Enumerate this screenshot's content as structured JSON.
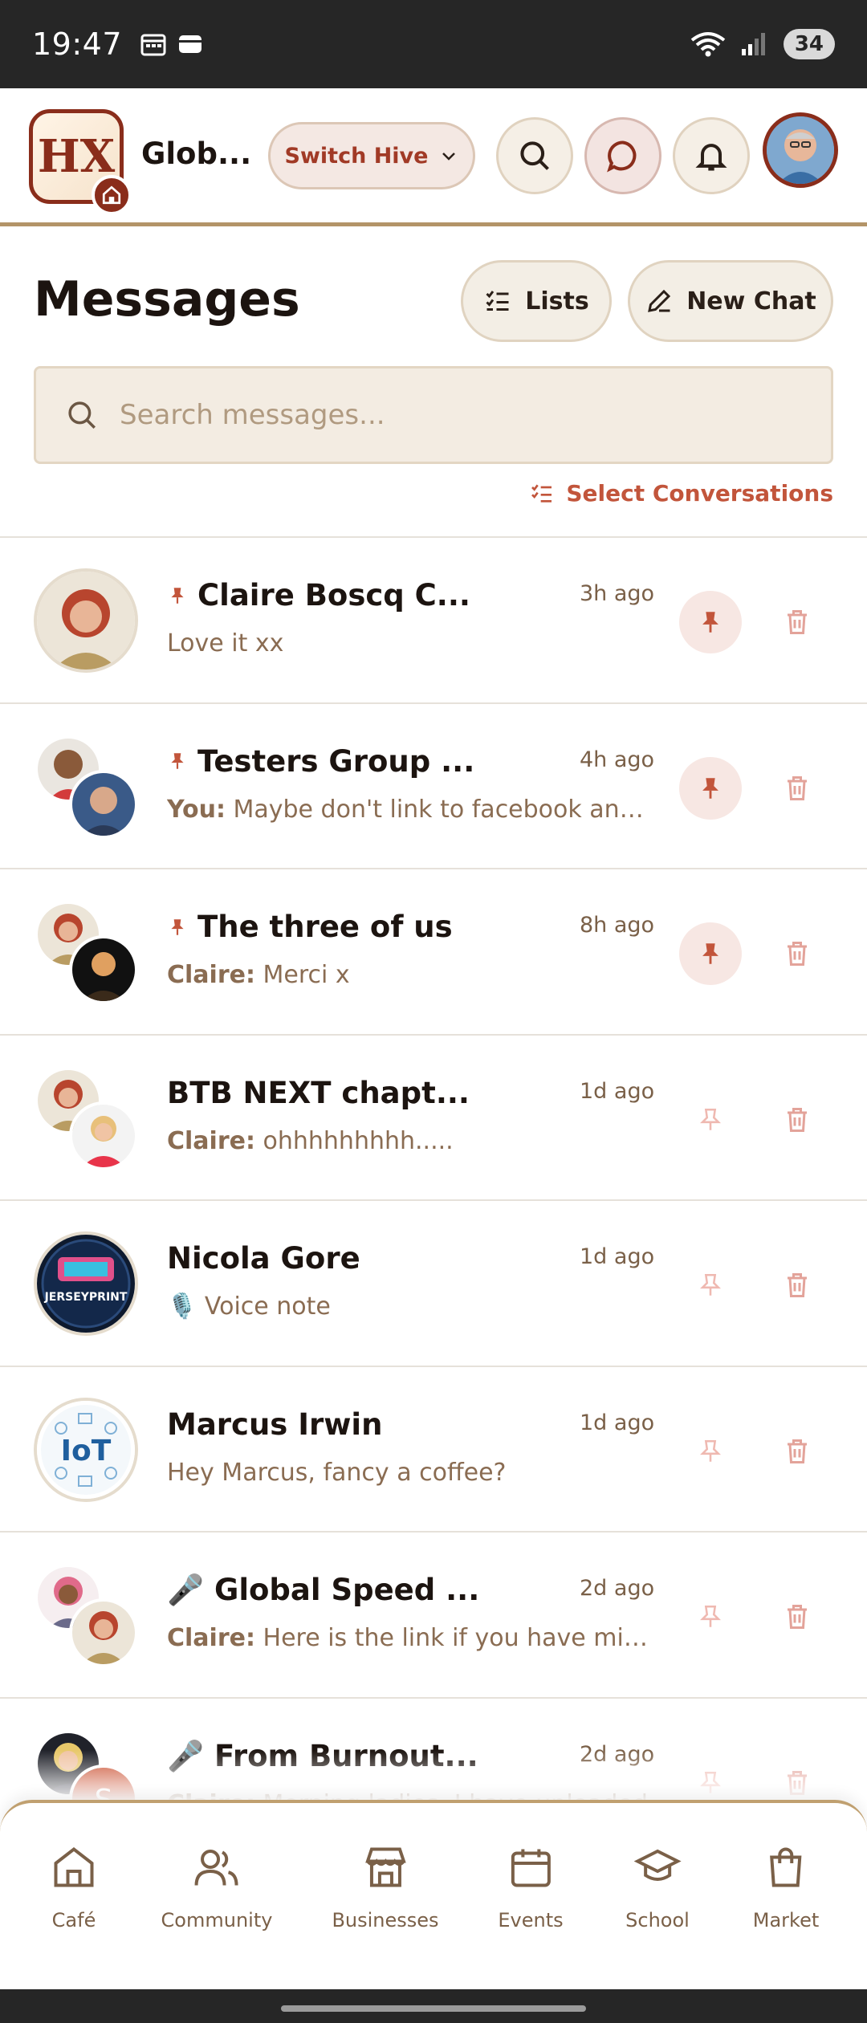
{
  "status_bar": {
    "time": "19:47",
    "battery": "34"
  },
  "header": {
    "logo_text": "HX",
    "hive_name": "Glob...",
    "switch_hive_label": "Switch Hive"
  },
  "page": {
    "title": "Messages",
    "lists_label": "Lists",
    "new_chat_label": "New Chat",
    "search_placeholder": "Search messages...",
    "select_conversations_label": "Select Conversations"
  },
  "conversations": [
    {
      "name": "Claire Boscq C...",
      "time": "3h ago",
      "sender": "",
      "preview": "Love it xx",
      "pinned": true
    },
    {
      "name": "Testers Group ...",
      "time": "4h ago",
      "sender": "You:",
      "preview": "Maybe don't link to facebook and just use the link",
      "pinned": true
    },
    {
      "name": "The three of us",
      "time": "8h ago",
      "sender": "Claire:",
      "preview": "Merci x",
      "pinned": true
    },
    {
      "name": "BTB NEXT chapt...",
      "time": "1d ago",
      "sender": "Claire:",
      "preview": "ohhhhhhhhh.....",
      "pinned": false
    },
    {
      "name": "Nicola Gore",
      "time": "1d ago",
      "sender": "",
      "preview": "🎙️ Voice note",
      "pinned": false
    },
    {
      "name": "Marcus Irwin",
      "time": "1d ago",
      "sender": "",
      "preview": "Hey Marcus, fancy a coffee?",
      "pinned": false
    },
    {
      "name": "🎤 Global Speed ...",
      "time": "2d ago",
      "sender": "Claire:",
      "preview": "Here is the link if you have missed it",
      "pinned": false
    },
    {
      "name": "🎤 From Burnout...",
      "time": "2d ago",
      "sender": "Claire:",
      "preview": "Morning ladies, I have uploaded",
      "pinned": false
    }
  ],
  "avatar_labels": {
    "print_badge": "JERSEYPRINT",
    "iot_badge": "IoT",
    "s_badge": "S"
  },
  "nav": [
    {
      "label": "Café",
      "icon": "home-icon"
    },
    {
      "label": "Community",
      "icon": "users-icon"
    },
    {
      "label": "Businesses",
      "icon": "store-icon"
    },
    {
      "label": "Events",
      "icon": "calendar-icon"
    },
    {
      "label": "School",
      "icon": "graduation-cap-icon"
    },
    {
      "label": "Market",
      "icon": "shopping-bag-icon"
    }
  ],
  "colors": {
    "accent": "#c2553b",
    "brand_dark": "#8a2d1b",
    "border_gold": "#b39468"
  }
}
